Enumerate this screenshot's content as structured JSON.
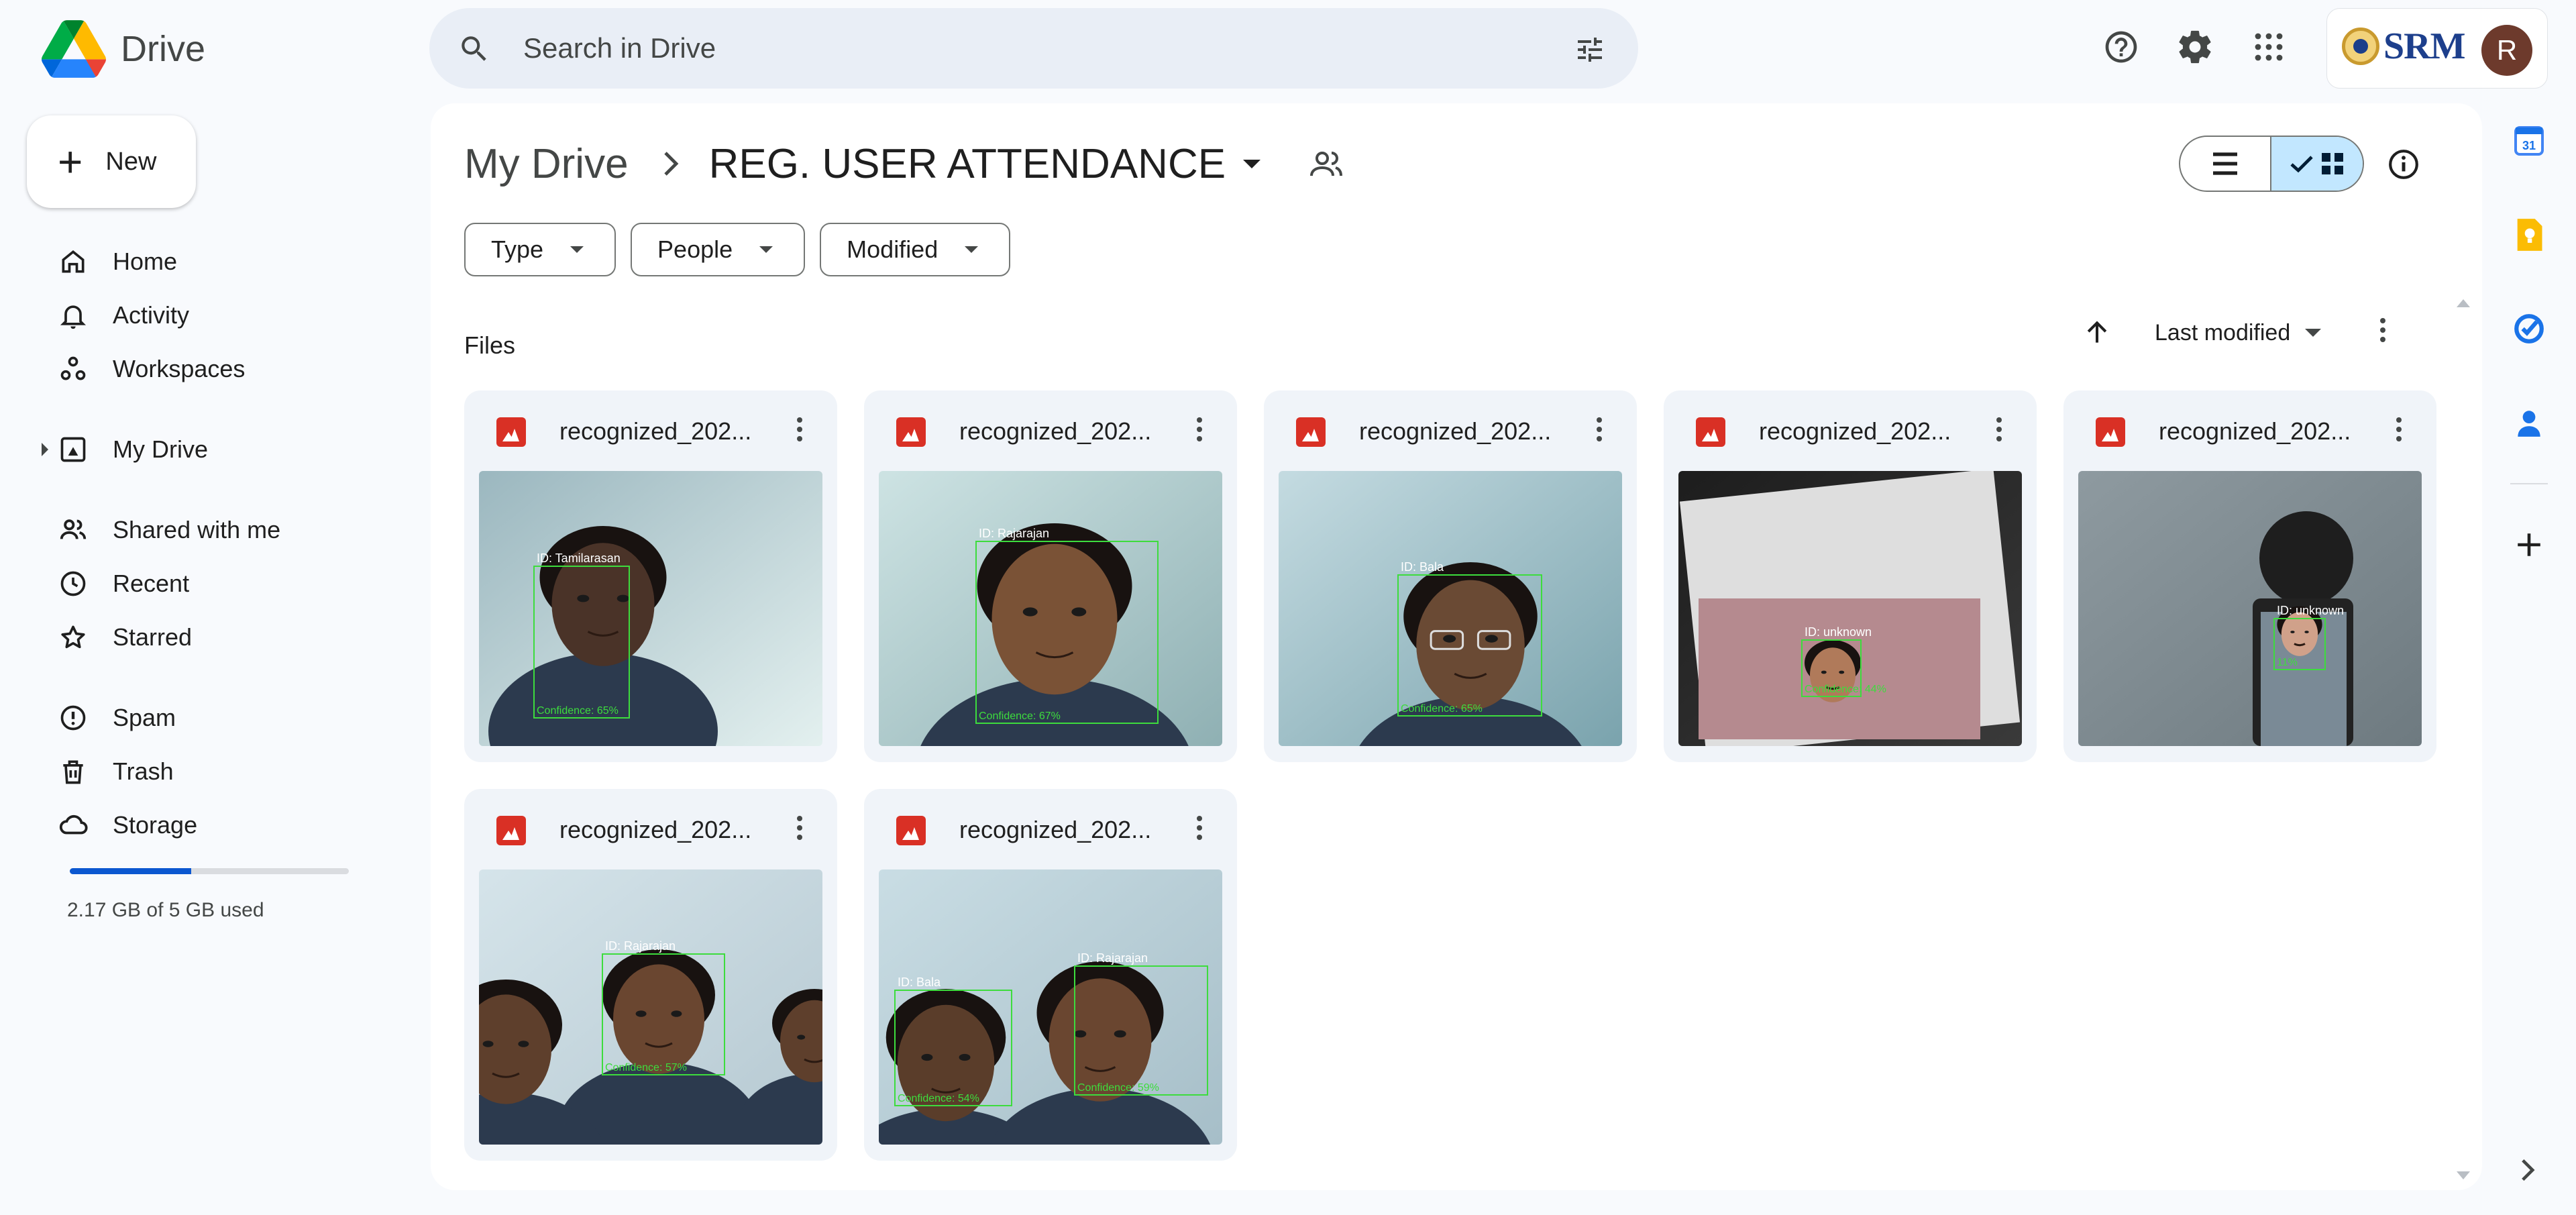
{
  "app": {
    "name": "Drive"
  },
  "search": {
    "placeholder": "Search in Drive"
  },
  "account": {
    "org_logo_text": "SRM",
    "avatar_letter": "R"
  },
  "sidebar": {
    "new_label": "New",
    "items": [
      {
        "label": "Home",
        "icon": "home-icon"
      },
      {
        "label": "Activity",
        "icon": "bell-icon"
      },
      {
        "label": "Workspaces",
        "icon": "workspaces-icon"
      },
      {
        "label": "My Drive",
        "icon": "my-drive-icon"
      },
      {
        "label": "Shared with me",
        "icon": "people-icon"
      },
      {
        "label": "Recent",
        "icon": "clock-icon"
      },
      {
        "label": "Starred",
        "icon": "star-icon"
      },
      {
        "label": "Spam",
        "icon": "spam-icon"
      },
      {
        "label": "Trash",
        "icon": "trash-icon"
      },
      {
        "label": "Storage",
        "icon": "cloud-icon"
      }
    ],
    "storage": {
      "text": "2.17 GB of 5 GB used",
      "used_fraction": 0.434
    }
  },
  "breadcrumb": {
    "root": "My Drive",
    "current": "REG. USER ATTENDANCE"
  },
  "filters": [
    "Type",
    "People",
    "Modified"
  ],
  "files": {
    "section_label": "Files",
    "sort_label": "Last modified",
    "items": [
      {
        "name": "recognized_202...",
        "tags": [
          {
            "id": "ID: Tamilarasan",
            "conf": "Confidence: 65%"
          }
        ]
      },
      {
        "name": "recognized_202...",
        "tags": [
          {
            "id": "ID: Rajarajan",
            "conf": "Confidence: 67%"
          }
        ]
      },
      {
        "name": "recognized_202...",
        "tags": [
          {
            "id": "ID: Bala",
            "conf": "Confidence: 65%"
          }
        ]
      },
      {
        "name": "recognized_202...",
        "tags": [
          {
            "id": "ID: unknown",
            "conf": "Confidence: 44%"
          }
        ]
      },
      {
        "name": "recognized_202...",
        "tags": [
          {
            "id": "ID: unknown",
            "conf": "11%"
          }
        ]
      },
      {
        "name": "recognized_202...",
        "tags": [
          {
            "id": "ID: Rajarajan",
            "conf": "Confidence: 57%"
          }
        ]
      },
      {
        "name": "recognized_202...",
        "tags": [
          {
            "id": "ID: Bala",
            "conf": "Confidence: 54%"
          },
          {
            "id": "ID: Rajarajan",
            "conf": "Confidence: 59%"
          }
        ]
      }
    ]
  },
  "colors": {
    "accent": "#0b57d0",
    "selected_toggle": "#c2e7ff",
    "file_icon": "#d93025",
    "face_box": "#3ddc3d"
  }
}
